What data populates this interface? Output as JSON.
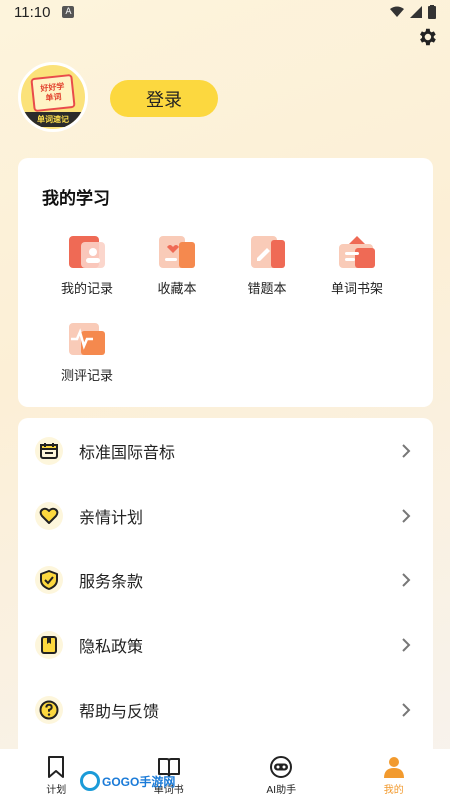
{
  "status_bar": {
    "time": "11:10",
    "notif": "A"
  },
  "profile": {
    "login_label": "登录",
    "avatar_top": "好好学",
    "avatar_mid": "单词",
    "avatar_label": "单词速记"
  },
  "study": {
    "title": "我的学习",
    "items": [
      {
        "label": "我的记录",
        "icon": "record-icon"
      },
      {
        "label": "收藏本",
        "icon": "favorites-icon"
      },
      {
        "label": "错题本",
        "icon": "mistakes-icon"
      },
      {
        "label": "单词书架",
        "icon": "bookshelf-icon"
      },
      {
        "label": "测评记录",
        "icon": "assessment-icon"
      }
    ]
  },
  "menu": {
    "items": [
      {
        "label": "标准国际音标",
        "icon": "phonetic-icon"
      },
      {
        "label": "亲情计划",
        "icon": "heart-icon"
      },
      {
        "label": "服务条款",
        "icon": "shield-icon"
      },
      {
        "label": "隐私政策",
        "icon": "privacy-book-icon"
      },
      {
        "label": "帮助与反馈",
        "icon": "help-icon"
      }
    ]
  },
  "tabs": [
    {
      "label": "计划",
      "icon": "bookmark-icon"
    },
    {
      "label": "单词书",
      "icon": "book-icon"
    },
    {
      "label": "AI助手",
      "icon": "robot-icon"
    },
    {
      "label": "我的",
      "icon": "person-icon",
      "active": true
    }
  ],
  "watermark": "GOGO手游网",
  "colors": {
    "accent": "#fcd83f",
    "active_tab": "#f29a2e",
    "icon_red": "#ef6a55"
  }
}
